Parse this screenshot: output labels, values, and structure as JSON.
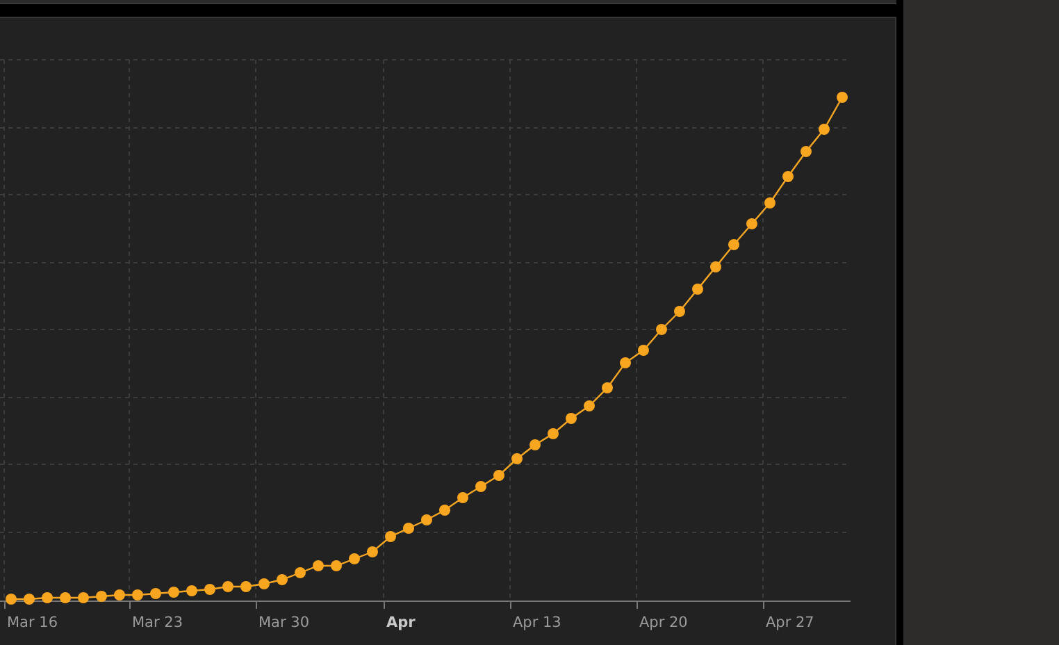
{
  "chart": {
    "x_labels": [
      {
        "text": "Mar 16",
        "emphasized": false
      },
      {
        "text": "Mar 23",
        "emphasized": false
      },
      {
        "text": "Mar 30",
        "emphasized": false
      },
      {
        "text": "Apr",
        "emphasized": true
      },
      {
        "text": "Apr 13",
        "emphasized": false
      },
      {
        "text": "Apr 20",
        "emphasized": false
      },
      {
        "text": "Apr 27",
        "emphasized": false
      }
    ]
  }
}
